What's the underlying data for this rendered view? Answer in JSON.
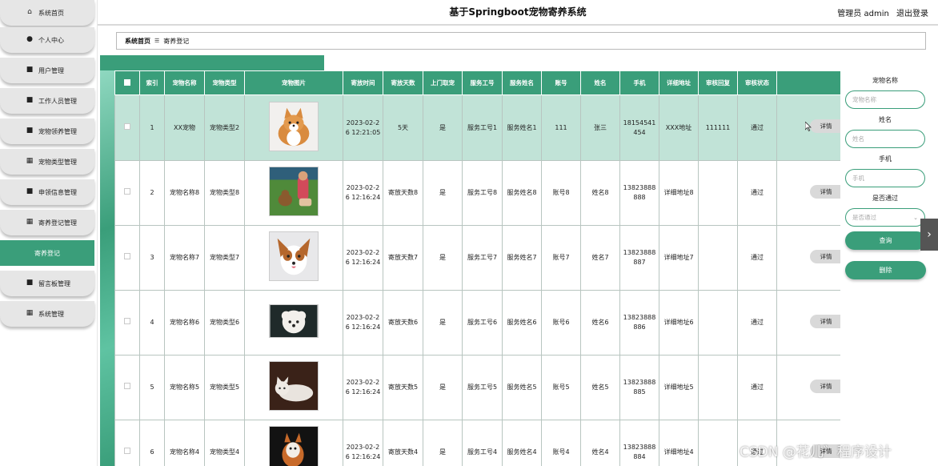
{
  "header": {
    "title": "基于Springboot宠物寄养系统",
    "user": "管理员 admin",
    "logout": "退出登录"
  },
  "sidebar": {
    "items": [
      {
        "label": "系统首页",
        "icon": "home-icon",
        "glyph": "⌂"
      },
      {
        "label": "个人中心",
        "icon": "user-icon",
        "glyph": "●"
      },
      {
        "label": "用户管理",
        "icon": "briefcase-icon",
        "glyph": "■"
      },
      {
        "label": "工作人员管理",
        "icon": "document-icon",
        "glyph": "■"
      },
      {
        "label": "宠物领养管理",
        "icon": "clipboard-icon",
        "glyph": "■"
      },
      {
        "label": "宠物类型管理",
        "icon": "grid-icon",
        "glyph": "▦"
      },
      {
        "label": "申领信息管理",
        "icon": "document-icon",
        "glyph": "■"
      },
      {
        "label": "寄养登记管理",
        "icon": "grid-icon",
        "glyph": "▦"
      },
      {
        "label": "寄养登记",
        "icon": "",
        "glyph": "",
        "active": true
      },
      {
        "label": "留言板管理",
        "icon": "board-icon",
        "glyph": "■"
      },
      {
        "label": "系统管理",
        "icon": "grid-icon",
        "glyph": "▦"
      }
    ]
  },
  "breadcrumb": {
    "home": "系统首页",
    "sep": "☰",
    "current": "寄养登记"
  },
  "table": {
    "headers": [
      "索引",
      "宠物名称",
      "宠物类型",
      "宠物图片",
      "寄放时间",
      "寄放天数",
      "上门取宠",
      "服务工号",
      "服务姓名",
      "账号",
      "姓名",
      "手机",
      "详细地址",
      "审核回复",
      "审核状态"
    ],
    "detail_label": "详情",
    "rows": [
      {
        "index": "1",
        "name": "XX宠物",
        "type": "宠物类型2",
        "time": "2023-02-26 12:21:05",
        "days": "5天",
        "pickup": "是",
        "work_no": "服务工号1",
        "service_name": "服务姓名1",
        "account": "111",
        "real_name": "张三",
        "phone": "18154541454",
        "address": "XXX地址",
        "reply": "111111",
        "status": "通过",
        "img": "corgi"
      },
      {
        "index": "2",
        "name": "宠物名称8",
        "type": "宠物类型8",
        "time": "2023-02-26 12:16:24",
        "days": "寄放天数8",
        "pickup": "是",
        "work_no": "服务工号8",
        "service_name": "服务姓名8",
        "account": "账号8",
        "real_name": "姓名8",
        "phone": "13823888888",
        "address": "详细地址8",
        "reply": "",
        "status": "通过",
        "img": "girl-dog"
      },
      {
        "index": "3",
        "name": "宠物名称7",
        "type": "宠物类型7",
        "time": "2023-02-26 12:16:24",
        "days": "寄放天数7",
        "pickup": "是",
        "work_no": "服务工号7",
        "service_name": "服务姓名7",
        "account": "账号7",
        "real_name": "姓名7",
        "phone": "13823888887",
        "address": "详细地址7",
        "reply": "",
        "status": "通过",
        "img": "papillon"
      },
      {
        "index": "4",
        "name": "宠物名称6",
        "type": "宠物类型6",
        "time": "2023-02-26 12:16:24",
        "days": "寄放天数6",
        "pickup": "是",
        "work_no": "服务工号6",
        "service_name": "服务姓名6",
        "account": "账号6",
        "real_name": "姓名6",
        "phone": "13823888886",
        "address": "详细地址6",
        "reply": "",
        "status": "通过",
        "img": "poodle"
      },
      {
        "index": "5",
        "name": "宠物名称5",
        "type": "宠物类型5",
        "time": "2023-02-26 12:16:24",
        "days": "寄放天数5",
        "pickup": "是",
        "work_no": "服务工号5",
        "service_name": "服务姓名5",
        "account": "账号5",
        "real_name": "姓名5",
        "phone": "13823888885",
        "address": "详细地址5",
        "reply": "",
        "status": "通过",
        "img": "cat"
      },
      {
        "index": "6",
        "name": "宠物名称4",
        "type": "宠物类型4",
        "time": "2023-02-26 12:16:24",
        "days": "寄放天数4",
        "pickup": "是",
        "work_no": "服务工号4",
        "service_name": "服务姓名4",
        "account": "账号4",
        "real_name": "姓名4",
        "phone": "13823888884",
        "address": "详细地址4",
        "reply": "",
        "status": "通过",
        "img": "dog-dark"
      }
    ]
  },
  "search": {
    "pet_name_label": "宠物名称",
    "pet_name_placeholder": "宠物名称",
    "name_label": "姓名",
    "name_placeholder": "姓名",
    "phone_label": "手机",
    "phone_placeholder": "手机",
    "pass_label": "是否通过",
    "pass_placeholder": "是否通过",
    "query_button": "查询",
    "delete_button": "删除"
  },
  "watermark": "CSDN @花儿゛程序设计",
  "colors": {
    "primary": "#3a9e7a",
    "highlight_row": "#c1e3d7"
  }
}
